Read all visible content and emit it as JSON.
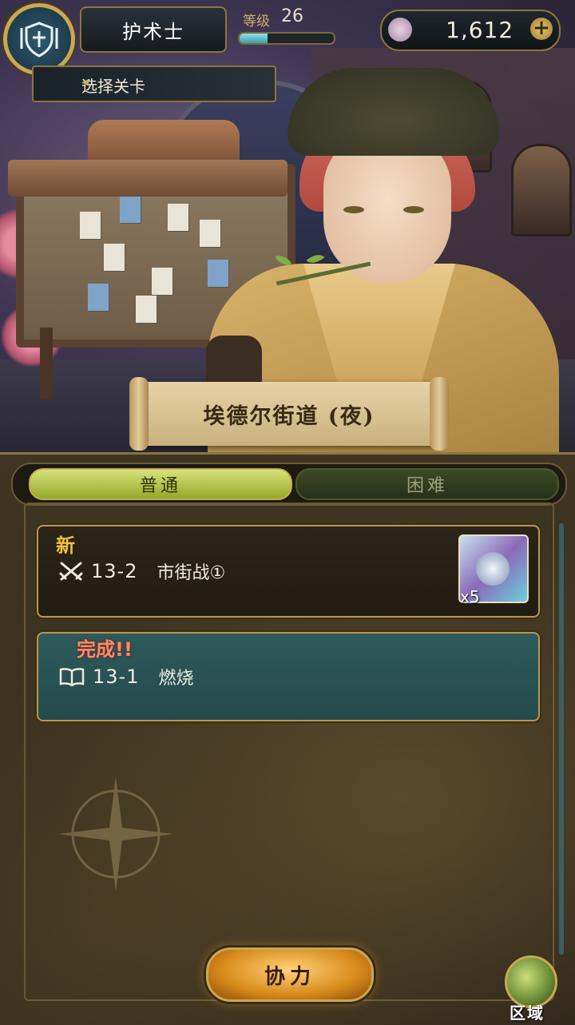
{
  "header": {
    "job_name": "护术士",
    "level_label": "等级",
    "level_value": "26",
    "level_progress": 0.3,
    "currency_value": "1,612",
    "stage_select_label": "选择关卡"
  },
  "area": {
    "title": "埃德尔街道 (夜)"
  },
  "tabs": {
    "normal": "普通",
    "hard": "困难"
  },
  "stages": [
    {
      "badge": "新",
      "icon": "crossed-swords-icon",
      "number": "13-2",
      "title": "市街战①",
      "reward_qty": "x5"
    },
    {
      "badge": "完成!!",
      "icon": "open-book-icon",
      "number": "13-1",
      "title": "燃烧"
    }
  ],
  "footer": {
    "coop_label": "协力",
    "region_label": "区域"
  },
  "colors": {
    "gold_frame": "#c8a855",
    "tab_active": "#c2d24a",
    "completed_card": "#2e5a5a",
    "new_badge": "#f2c040",
    "done_badge": "#ff8a6a"
  }
}
